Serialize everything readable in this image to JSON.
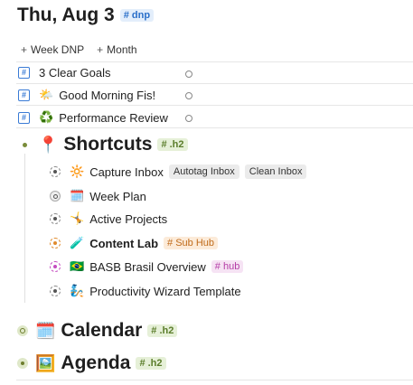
{
  "page": {
    "title": "Thu, Aug 3",
    "tag": "# dnp"
  },
  "actions": [
    {
      "label": "Week DNP"
    },
    {
      "label": "Month"
    }
  ],
  "refs": [
    {
      "emoji": "",
      "label": "3 Clear Goals"
    },
    {
      "emoji": "🌤️",
      "label": "Good Morning Fis!"
    },
    {
      "emoji": "♻️",
      "label": "Performance Review"
    }
  ],
  "shortcuts": {
    "emoji": "📍",
    "heading": "Shortcuts",
    "tag": "# .h2",
    "items": [
      {
        "emoji": "🔆",
        "label": "Capture Inbox",
        "buttons": [
          "Autotag Inbox",
          "Clean Inbox"
        ]
      },
      {
        "emoji": "🗓️",
        "label": "Week Plan"
      },
      {
        "emoji": "🤸",
        "label": "Active Projects"
      },
      {
        "emoji": "🧪",
        "label": "Content Lab",
        "tag": "# Sub Hub"
      },
      {
        "emoji": "🇧🇷",
        "label": "BASB Brasil Overview",
        "tag": "# hub"
      },
      {
        "emoji": "🧞",
        "label": "Productivity Wizard Template"
      }
    ]
  },
  "calendar": {
    "emoji": "🗓️",
    "heading": "Calendar",
    "tag": "# .h2"
  },
  "agenda": {
    "emoji": "🖼️",
    "heading": "Agenda",
    "tag": "# .h2"
  }
}
